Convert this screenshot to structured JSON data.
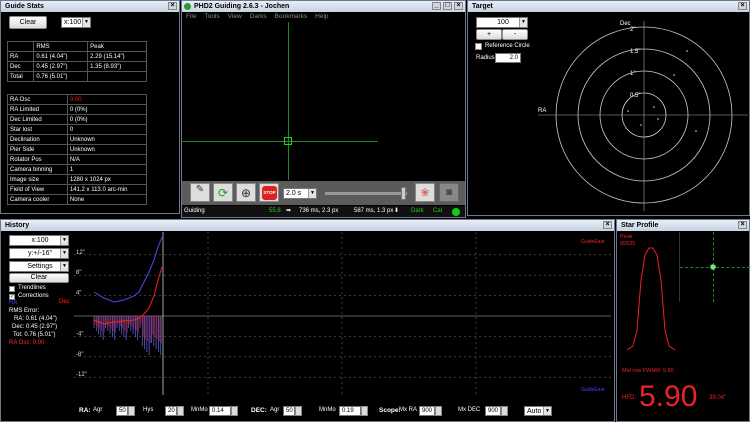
{
  "guide_stats": {
    "title": "Guide Stats",
    "clear": "Clear",
    "scale": "x:100",
    "summary": {
      "headers": [
        "",
        "RMS",
        "Peak"
      ],
      "rows": [
        [
          "RA",
          "0.61 (4.04\")",
          "2.29 (15.14\")"
        ],
        [
          "Dec",
          "0.45 (2.97\")",
          "1.35 (8.93\")"
        ],
        [
          "Total",
          "0.76 (5.01\")",
          ""
        ]
      ]
    },
    "info": [
      [
        "RA Osc",
        "0.00"
      ],
      [
        "RA Limited",
        "0 (0%)"
      ],
      [
        "Dec Limited",
        "0 (0%)"
      ],
      [
        "Star lost",
        "0"
      ],
      [
        "Declination",
        "Unknown"
      ],
      [
        "Pier Side",
        "Unknown"
      ],
      [
        "Rotator Pos",
        "N/A"
      ],
      [
        "Camera binning",
        "1"
      ],
      [
        "Image size",
        "1280 x 1024 px"
      ],
      [
        "Field of View",
        "141.2 x 113.0  arc-min"
      ],
      [
        "Camera cooler",
        "None"
      ]
    ]
  },
  "main": {
    "title": "PHD2 Guiding 2.6.3 - Jochen",
    "menu": [
      "File",
      "Tools",
      "View",
      "Darks",
      "Bookmarks",
      "Help"
    ],
    "exposure": "2.0 s",
    "status": {
      "state": "Guiding",
      "snr": "55.8",
      "ra": "736 ms, 2.3 px",
      "dec": "587 ms, 1.3 px",
      "dark": "Dark",
      "cal": "Cal"
    }
  },
  "target": {
    "title": "Target",
    "scale": "100",
    "plus": "+",
    "minus": "-",
    "ref_circle": "Reference Circle",
    "radius_label": "Radius:",
    "radius": "2.0",
    "ra_label": "RA",
    "dec_label": "Dec",
    "rings": [
      "0.5\"",
      "1\"",
      "1.5\"",
      "2\""
    ]
  },
  "history": {
    "title": "History",
    "xscale": "x:100",
    "yscale": "y:+/-16\"",
    "settings": "Settings",
    "clear": "Clear",
    "trendlines": "Trendlines",
    "corrections": "Corrections",
    "ra_legend": "RA",
    "dec_legend": "Dec",
    "rms_title": "RMS Error:",
    "rms_ra": "RA: 0.61 (4.04\")",
    "rms_dec": "Dec: 0.45 (2.97\")",
    "rms_tot": "Tot: 0.76 (5.01\")",
    "ra_osc": "RA Osc: 0.00",
    "yticks": [
      "12\"",
      "8\"",
      "4\"",
      "-4\"",
      "-8\"",
      "-12\""
    ],
    "guide_top": "GuideEast",
    "guide_bottom": "GuideEast",
    "controls": {
      "ra": "RA:",
      "ra_agr_l": "Agr",
      "ra_agr": "50",
      "hys_l": "Hys",
      "hys": "20",
      "mnmo_l": "MnMo",
      "mnmo": "0.14",
      "dec": "DEC:",
      "dec_agr_l": "Agr",
      "dec_agr": "50",
      "dec_mnmo_l": "MnMo",
      "dec_mnmo": "0.19",
      "scope": "Scope:",
      "mxra_l": "Mx RA",
      "mxra": "900",
      "mxdec_l": "Mx DEC",
      "mxdec": "900",
      "mode": "Auto"
    }
  },
  "star_profile": {
    "title": "Star Profile",
    "peak_l": "Peak",
    "peak": "65535",
    "mid_row": "Mid row FWHM: 5.90",
    "hfd_l": "HFD:",
    "hfd": "5.90",
    "arcsec": "39.04\""
  },
  "colors": {
    "ra": "#4040ff",
    "dec": "#ff2020",
    "grid": "#888"
  }
}
